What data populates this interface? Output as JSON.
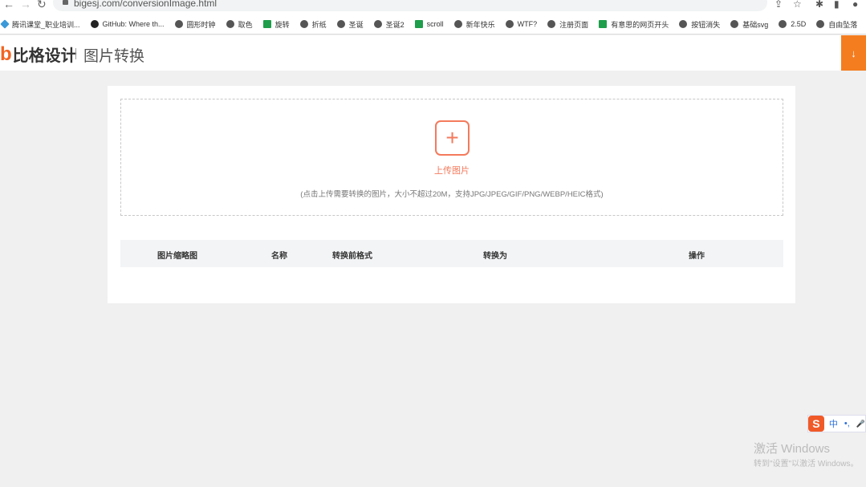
{
  "browser": {
    "url": "bigesj.com/conversionImage.html",
    "bookmarks": [
      "腾讯课堂_职业培训...",
      "GitHub: Where th...",
      "圆形时钟",
      "取色",
      "旋转",
      "折纸",
      "圣诞",
      "圣诞2",
      "scroll",
      "新年快乐",
      "WTF?",
      "注册页面",
      "有意思的网页开头",
      "按钮消失",
      "基础svg",
      "2.5D",
      "自由坠落"
    ],
    "bookmark_icons": [
      "tencent-icon",
      "github-icon",
      "globe-icon",
      "globe-icon",
      "sheet-icon",
      "globe-icon",
      "globe-icon",
      "globe-icon",
      "sheet-icon",
      "globe-icon",
      "globe-icon",
      "globe-icon",
      "sheet-icon",
      "globe-icon",
      "globe-icon",
      "globe-icon",
      "globe-icon"
    ]
  },
  "header": {
    "logo_mark": "b",
    "logo_text": "比格设计",
    "page_title": "图片转换",
    "download_icon": "↓"
  },
  "upload": {
    "plus": "+",
    "label": "上传图片",
    "hint": "(点击上传需要转换的图片，大小不超过20M，支持JPG/JPEG/GIF/PNG/WEBP/HEIC格式)"
  },
  "table": {
    "columns": [
      "图片缩略图",
      "名称",
      "转换前格式",
      "转换为",
      "操作"
    ]
  },
  "ime": {
    "logo": "S",
    "mode": "中",
    "punct": "•,",
    "mic": "🎤"
  },
  "watermark": {
    "title": "激活 Windows",
    "subtitle": "转到\"设置\"以激活 Windows。"
  },
  "colors": {
    "accent": "#f47a5c",
    "download": "#f47d20"
  }
}
